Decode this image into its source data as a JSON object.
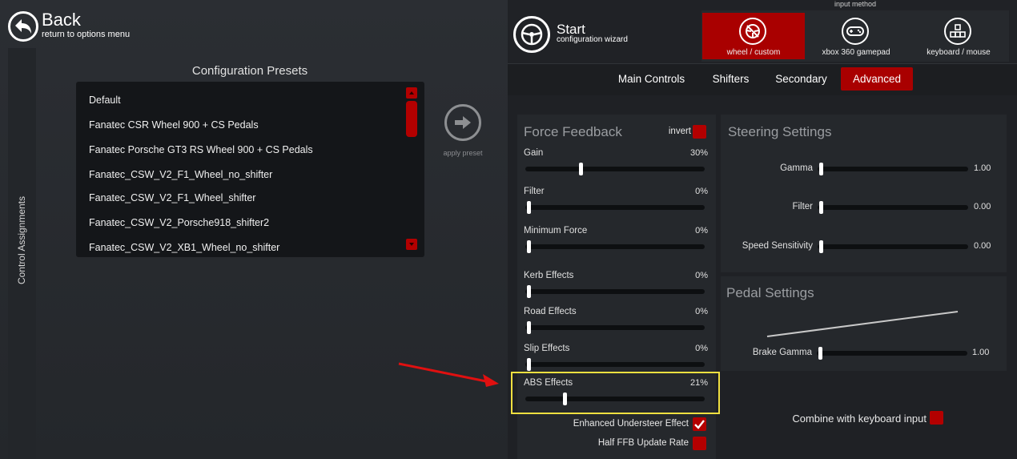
{
  "header": {
    "back_title": "Back",
    "back_subtitle": "return to options menu",
    "start_title": "Start",
    "start_subtitle": "configuration wizard"
  },
  "sidebar": {
    "label": "Control Assignments"
  },
  "presets": {
    "title": "Configuration Presets",
    "items": [
      "Default",
      "Fanatec CSR Wheel 900 + CS Pedals",
      "Fanatec Porsche GT3 RS Wheel 900 + CS Pedals",
      "Fanatec_CSW_V2_F1_Wheel_no_shifter",
      "Fanatec_CSW_V2_F1_Wheel_shifter",
      "Fanatec_CSW_V2_Porsche918_shifter2",
      "Fanatec_CSW_V2_XB1_Wheel_no_shifter"
    ],
    "apply_label": "apply preset"
  },
  "input_method": {
    "label": "input method",
    "options": [
      {
        "label": "wheel / custom",
        "icon": "steering-wheel-icon",
        "selected": true
      },
      {
        "label": "xbox 360 gamepad",
        "icon": "gamepad-icon",
        "selected": false
      },
      {
        "label": "keyboard / mouse",
        "icon": "keyboard-icon",
        "selected": false
      }
    ]
  },
  "tabs": [
    {
      "label": "Main Controls",
      "active": false
    },
    {
      "label": "Shifters",
      "active": false
    },
    {
      "label": "Secondary",
      "active": false
    },
    {
      "label": "Advanced",
      "active": true
    }
  ],
  "force_feedback": {
    "title": "Force Feedback",
    "invert_label": "invert",
    "invert_checked": false,
    "sliders": [
      {
        "label": "Gain",
        "value": "30%",
        "level": 0.3
      },
      {
        "label": "Filter",
        "value": "0%",
        "level": 0.0
      },
      {
        "label": "Minimum Force",
        "value": "0%",
        "level": 0.0
      },
      {
        "label": "Kerb Effects",
        "value": "0%",
        "level": 0.0
      },
      {
        "label": "Road Effects",
        "value": "0%",
        "level": 0.0
      },
      {
        "label": "Slip Effects",
        "value": "0%",
        "level": 0.0
      },
      {
        "label": "ABS Effects",
        "value": "21%",
        "level": 0.21
      }
    ],
    "enhanced_understeer_label": "Enhanced Understeer Effect",
    "enhanced_understeer_checked": true,
    "half_ffb_label": "Half FFB Update Rate",
    "half_ffb_checked": false
  },
  "steering": {
    "title": "Steering Settings",
    "sliders": [
      {
        "label": "Gamma",
        "value": "1.00",
        "level": 0.0
      },
      {
        "label": "Filter",
        "value": "0.00",
        "level": 0.0
      },
      {
        "label": "Speed Sensitivity",
        "value": "0.00",
        "level": 0.0
      }
    ]
  },
  "pedal": {
    "title": "Pedal Settings",
    "sliders": [
      {
        "label": "Brake Gamma",
        "value": "1.00",
        "level": 0.0
      }
    ]
  },
  "combine_keyboard_label": "Combine with keyboard input",
  "combine_keyboard_checked": false,
  "colors": {
    "accent": "#a90000",
    "highlight": "#f0e040",
    "arrow": "#e01010"
  }
}
